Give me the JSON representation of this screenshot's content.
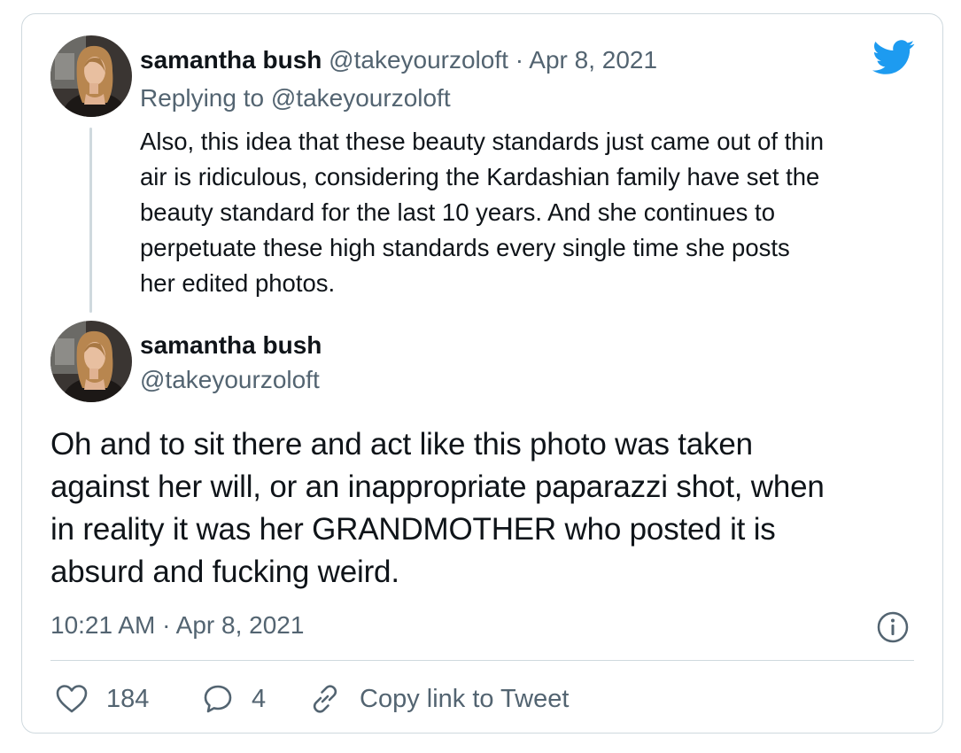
{
  "brand": {
    "icon": "twitter-bird-icon",
    "color": "#1d9bf0"
  },
  "reply_tweet": {
    "author_name": "samantha bush",
    "author_handle": "@takeyourzoloft",
    "separator": "·",
    "date": "Apr 8, 2021",
    "replying_prefix": "Replying to ",
    "replying_handle": "@takeyourzoloft",
    "text_lines": [
      "Also, this idea that these beauty standards just came out of thin",
      "air is ridiculous, considering the Kardashian family have set the",
      "beauty standard for the last 10 years. And she continues to",
      "perpetuate these high standards every single time she posts",
      "her edited photos."
    ]
  },
  "main_tweet": {
    "author_name": "samantha bush",
    "author_handle": "@takeyourzoloft",
    "text_lines": [
      "Oh and to sit there and act like this photo was taken",
      "against her will, or an inappropriate paparazzi shot, when",
      "in reality it was her GRANDMOTHER who posted it is",
      "absurd and fucking weird."
    ],
    "timestamp": "10:21 AM · Apr 8, 2021",
    "info_icon": "info-icon"
  },
  "actions": {
    "likes": {
      "icon": "heart-icon",
      "count": "184"
    },
    "replies": {
      "icon": "reply-bubble-icon",
      "count": "4"
    },
    "copy_link": {
      "icon": "link-icon",
      "label": "Copy link to Tweet"
    }
  }
}
